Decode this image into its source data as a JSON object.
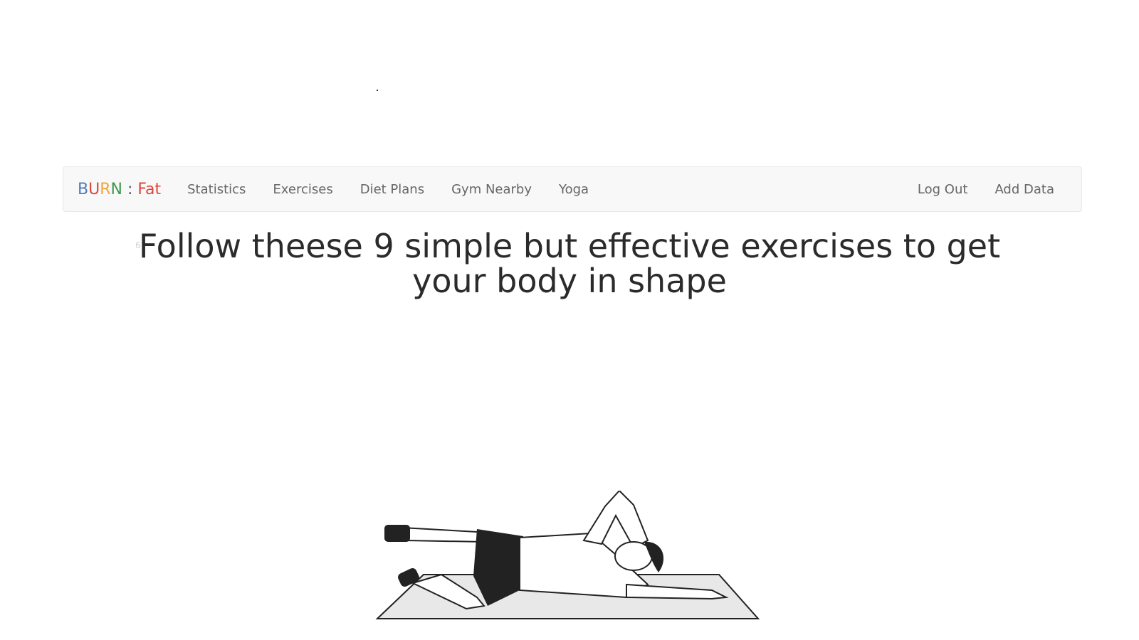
{
  "brand": {
    "letters": [
      {
        "char": "B",
        "color": "#4f7cc1"
      },
      {
        "char": "U",
        "color": "#e0453b"
      },
      {
        "char": "R",
        "color": "#f0a53a"
      },
      {
        "char": "N",
        "color": "#3c9a4f"
      }
    ],
    "separator": " : ",
    "separator_color": "#555555",
    "suffix": "Fat",
    "suffix_color": "#e0453b"
  },
  "nav": {
    "left": [
      "Statistics",
      "Exercises",
      "Diet Plans",
      "Gym Nearby",
      "Yoga"
    ],
    "right": [
      "Log Out",
      "Add Data"
    ]
  },
  "main": {
    "headline": "Follow theese 9 simple but effective exercises to get your body in shape",
    "ghost_text": "6"
  },
  "illustration": {
    "icon": "side-lying-leg-raise-exercise-illustration",
    "mat_fill": "#e8e8e8",
    "line_color": "#222222"
  }
}
